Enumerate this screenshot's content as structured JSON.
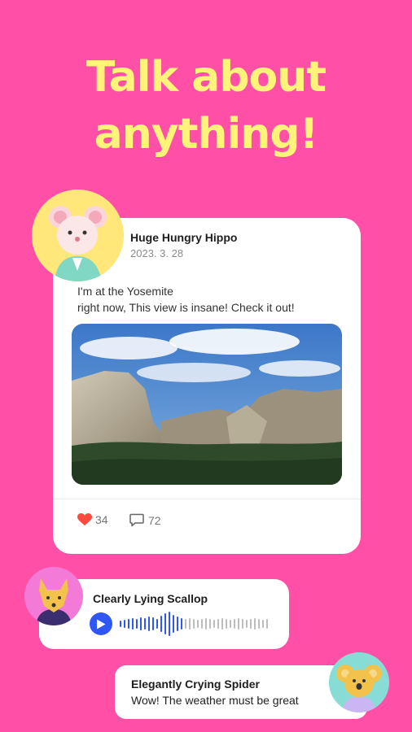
{
  "headline": {
    "line1": "Talk about",
    "line2": "anything!"
  },
  "post": {
    "author": "Huge Hungry Hippo",
    "date": "2023. 3. 28",
    "text_line1": "I'm at the Yosemite",
    "text_line2": "right now, This view is insane! Check it out!",
    "likes": "34",
    "comments": "72"
  },
  "voice_message": {
    "sender": "Clearly Lying Scallop"
  },
  "chat_message": {
    "sender": "Elegantly Crying Spider",
    "text": "Wow! The weather must be great"
  },
  "colors": {
    "background": "#FF4FA6",
    "headline": "#FFF47A",
    "accent_blue": "#2F57F5",
    "like_red": "#FF4B3E"
  },
  "icons": [
    "heart-icon",
    "comment-icon",
    "play-icon"
  ]
}
